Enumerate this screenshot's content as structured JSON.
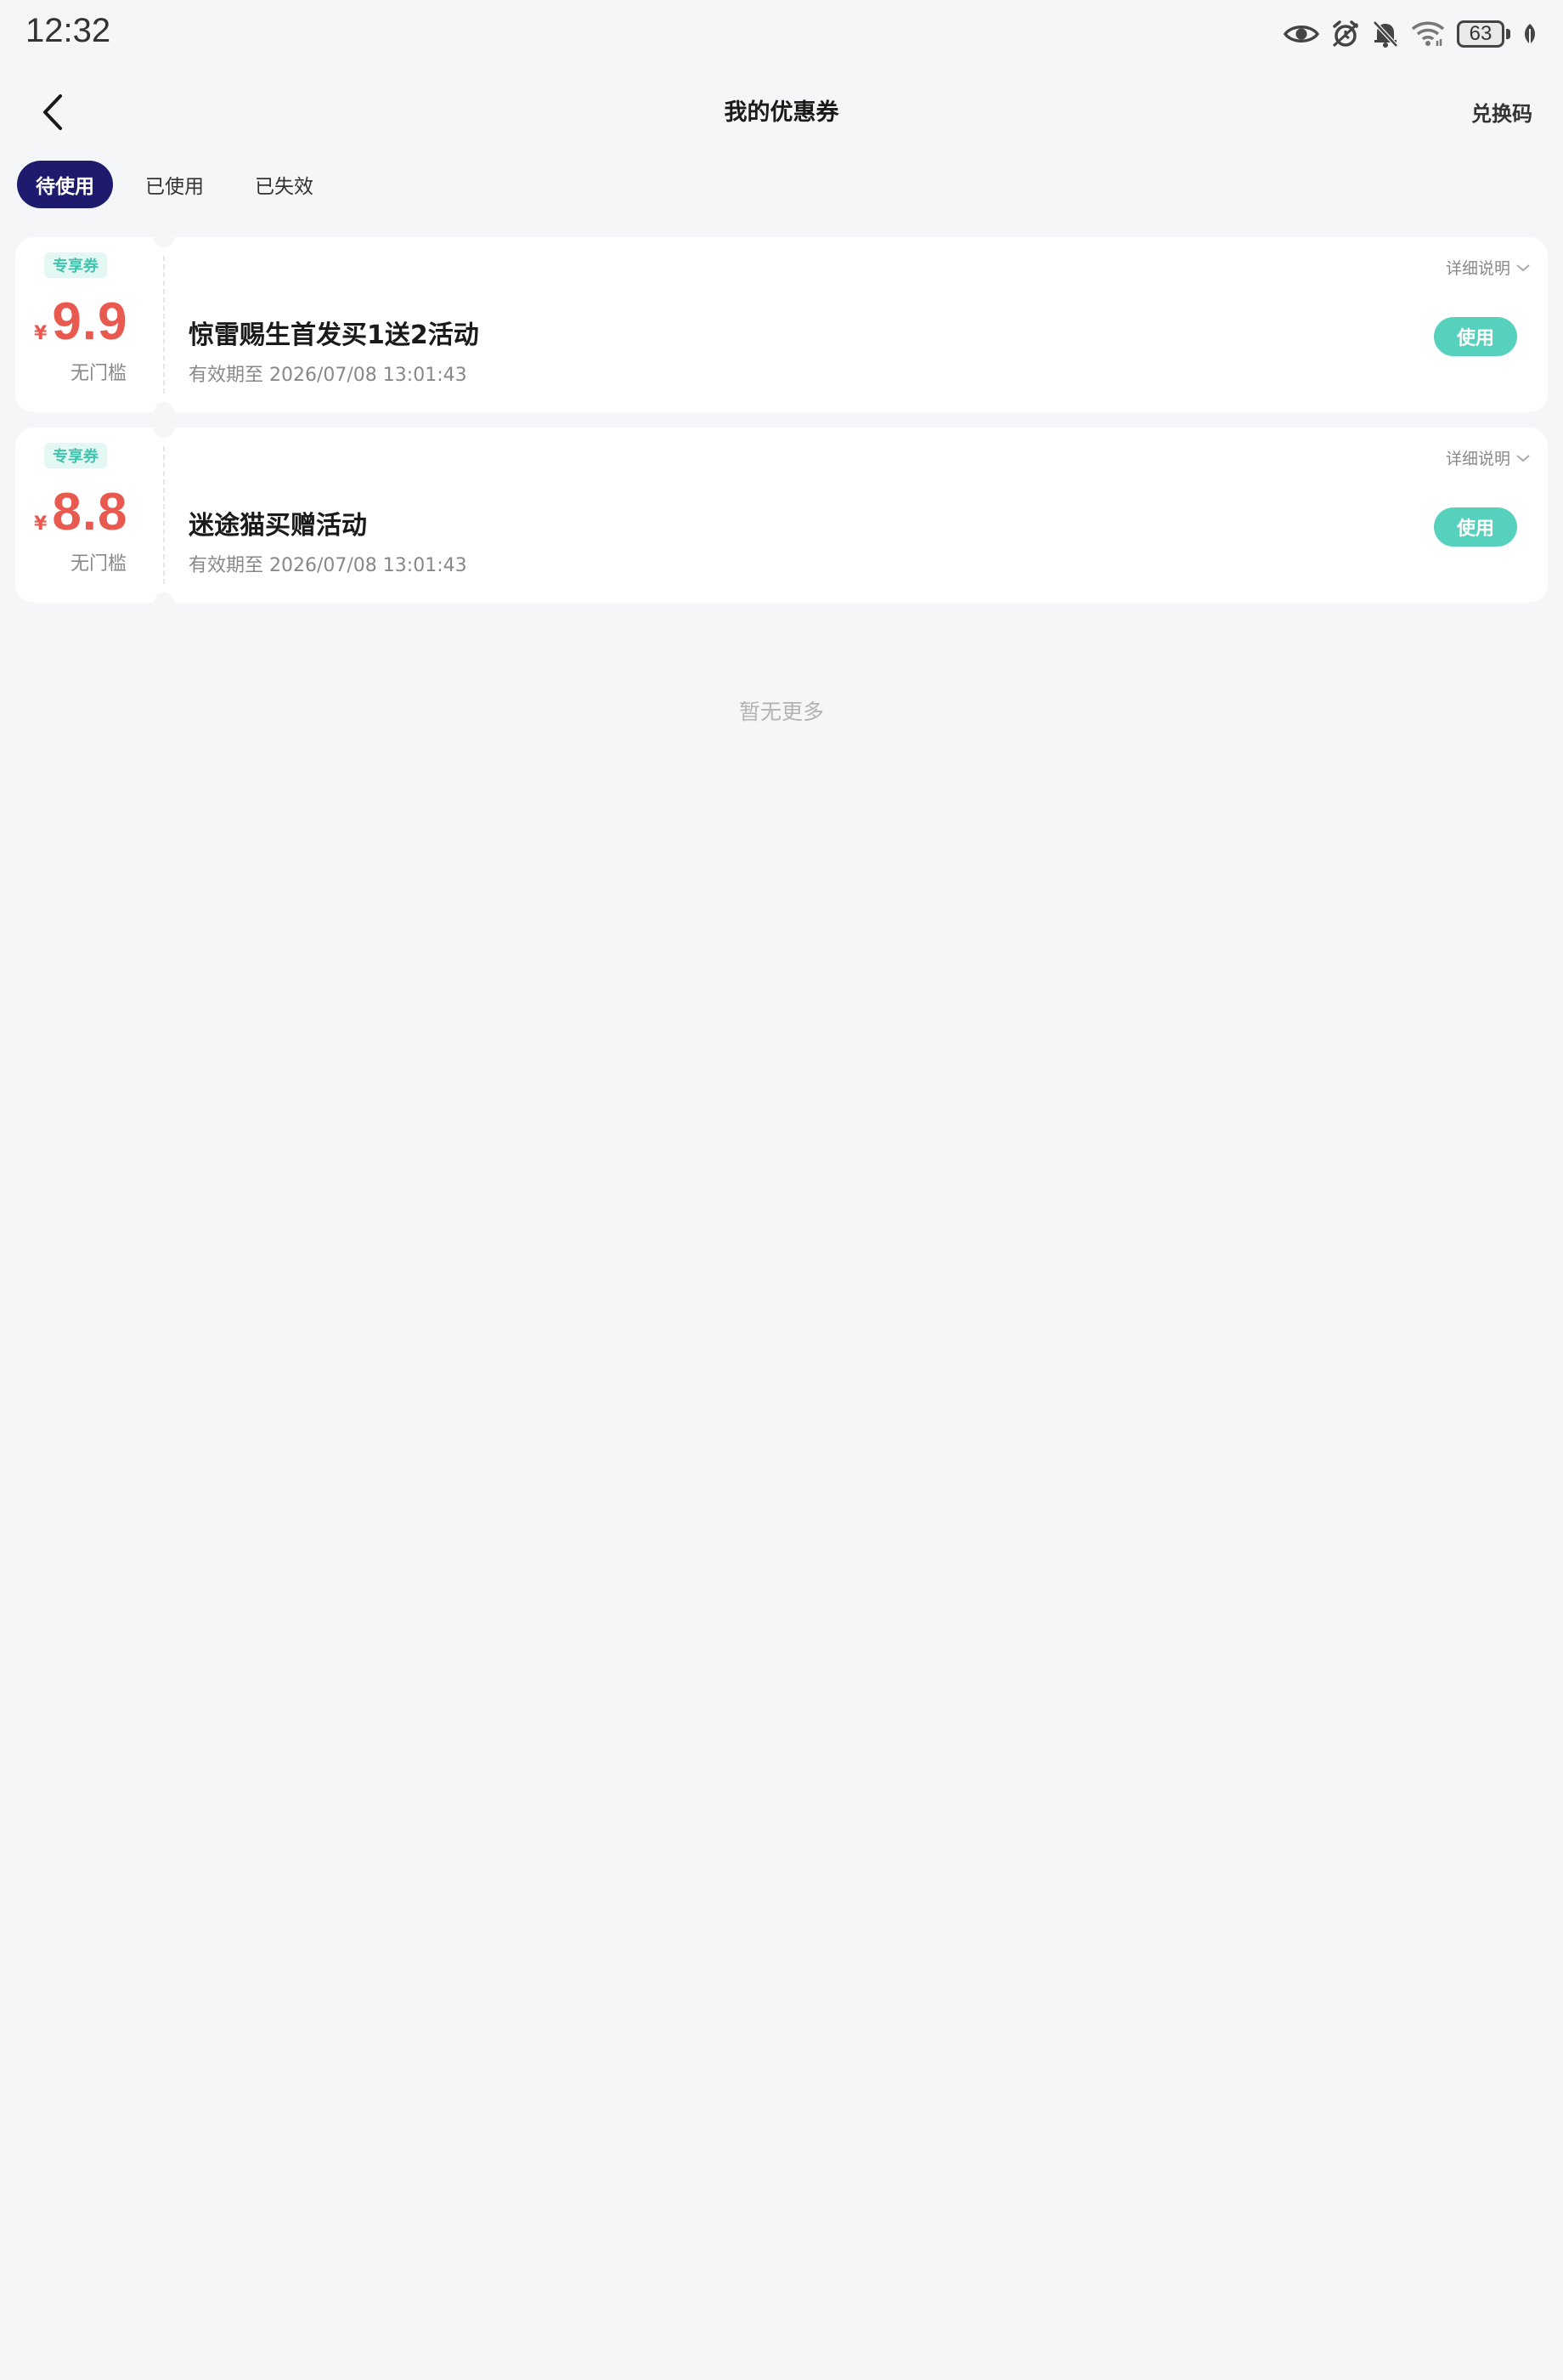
{
  "status_bar": {
    "time": "12:32",
    "battery": "63",
    "icons": [
      "eye-icon",
      "alarm-icon",
      "bell-off-icon",
      "wifi-icon",
      "battery-icon",
      "leaf-icon"
    ]
  },
  "nav": {
    "title": "我的优惠券",
    "redeem_label": "兑换码"
  },
  "tabs": [
    {
      "label": "待使用",
      "active": true
    },
    {
      "label": "已使用",
      "active": false
    },
    {
      "label": "已失效",
      "active": false
    }
  ],
  "coupons": [
    {
      "tag": "专享券",
      "currency": "¥",
      "amount": "9.9",
      "threshold": "无门槛",
      "title": "惊雷赐生首发买1送2活动",
      "expiry": "有效期至 2026/07/08 13:01:43",
      "detail_label": "详细说明",
      "use_label": "使用"
    },
    {
      "tag": "专享券",
      "currency": "¥",
      "amount": "8.8",
      "threshold": "无门槛",
      "title": "迷途猫买赠活动",
      "expiry": "有效期至 2026/07/08 13:01:43",
      "detail_label": "详细说明",
      "use_label": "使用"
    }
  ],
  "footer": {
    "no_more": "暂无更多"
  },
  "colors": {
    "background": "#f5f6f8",
    "active_tab": "#1e1a6e",
    "amount": "#e85a4f",
    "accent_teal": "#56d1bd"
  }
}
